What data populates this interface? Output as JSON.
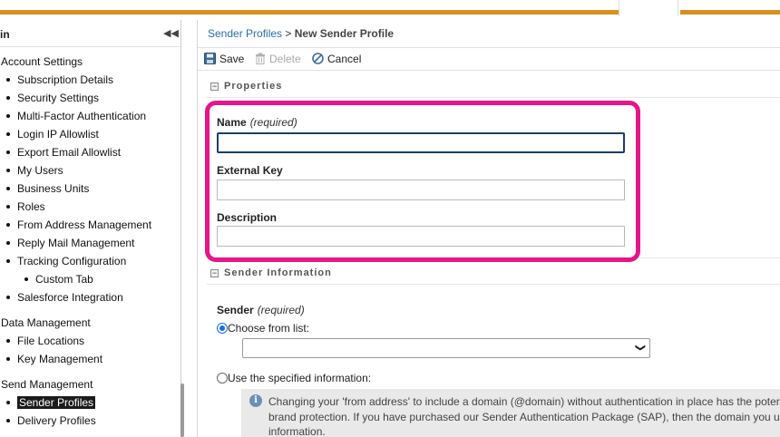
{
  "sidebar": {
    "title": "in",
    "collapse_icon": "◀◀",
    "sections": [
      {
        "label": "Account Settings"
      },
      {
        "label": "Data Management"
      },
      {
        "label": "Send Management"
      }
    ],
    "items": [
      {
        "label": "Subscription Details"
      },
      {
        "label": "Security Settings"
      },
      {
        "label": "Multi-Factor Authentication"
      },
      {
        "label": "Login IP Allowlist"
      },
      {
        "label": "Export Email Allowlist"
      },
      {
        "label": "My Users"
      },
      {
        "label": "Business Units"
      },
      {
        "label": "Roles"
      },
      {
        "label": "From Address Management"
      },
      {
        "label": "Reply Mail Management"
      },
      {
        "label": "Tracking Configuration"
      },
      {
        "label": "Custom Tab"
      },
      {
        "label": "Salesforce Integration"
      },
      {
        "label": "File Locations"
      },
      {
        "label": "Key Management"
      },
      {
        "label": "Sender Profiles"
      },
      {
        "label": "Delivery Profiles"
      }
    ]
  },
  "breadcrumb": {
    "parent": "Sender Profiles",
    "separator": " > ",
    "current": "New Sender Profile"
  },
  "toolbar": {
    "save_label": "Save",
    "delete_label": "Delete",
    "cancel_label": "Cancel"
  },
  "properties": {
    "section_title": "Properties",
    "name_label": "Name",
    "required_text": "(required)",
    "name_value": "",
    "external_key_label": "External Key",
    "external_key_value": "",
    "description_label": "Description",
    "description_value": ""
  },
  "sender_information": {
    "section_title": "Sender Information",
    "sender_label": "Sender",
    "required_text": "(required)",
    "option_choose": "Choose from list:",
    "option_specified": "Use the specified information:",
    "selected_option": "choose",
    "select_value": "",
    "info_lines": [
      "Changing your 'from address' to include a domain (@domain) without authentication in place has the poter",
      "brand protection. If you have purchased our Sender Authentication Package (SAP), then the domain you u",
      "information."
    ]
  },
  "colors": {
    "accent_stripe": "#d8901d",
    "highlight_border": "#e4168a",
    "link": "#2a6ea6"
  }
}
